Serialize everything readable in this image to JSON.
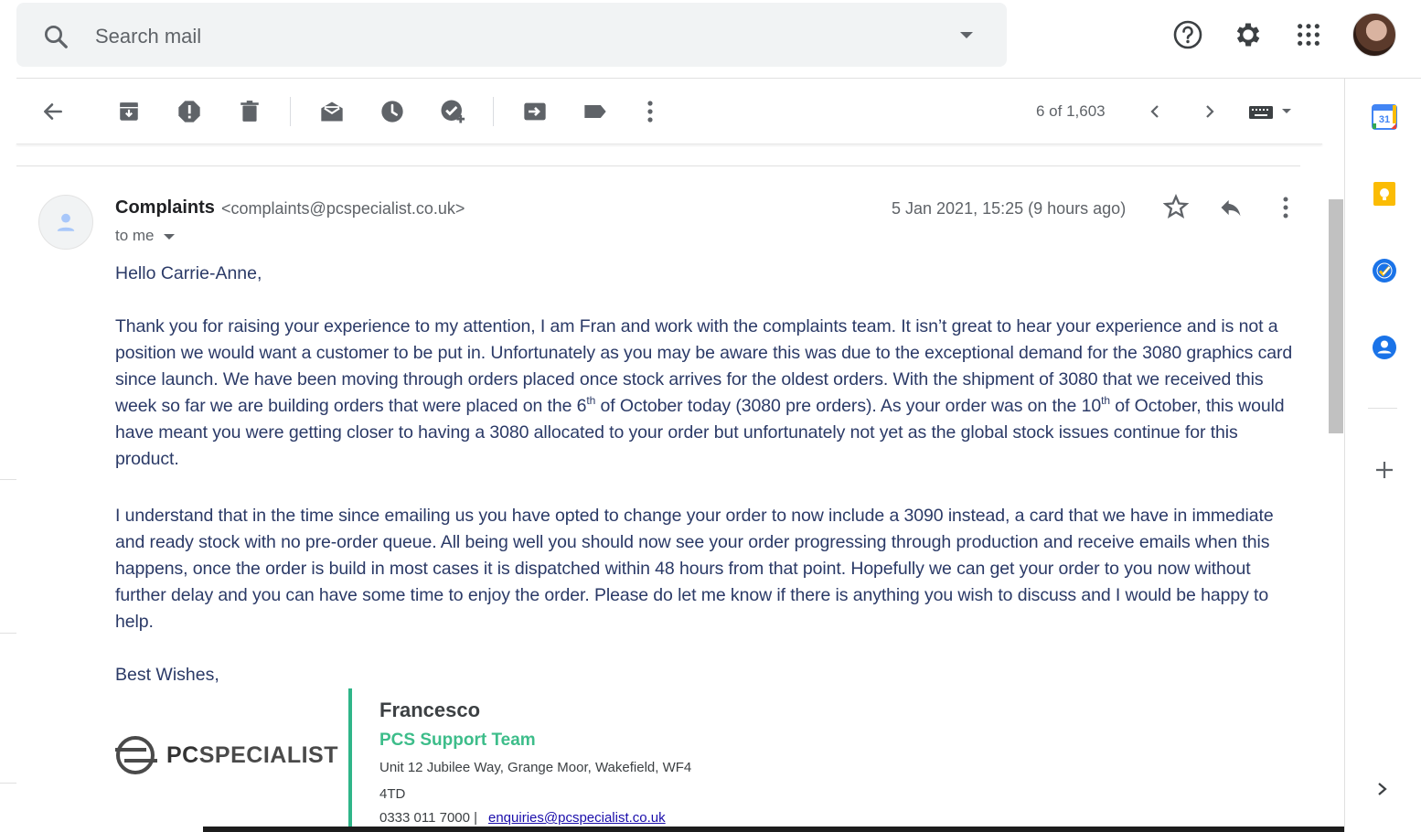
{
  "search": {
    "placeholder": "Search mail"
  },
  "toolbar": {
    "pager": "6 of 1,603"
  },
  "message": {
    "sender_name": "Complaints",
    "sender_email": "<complaints@pcspecialist.co.uk>",
    "recipient": "to me",
    "date": "5 Jan 2021, 15:25 (9 hours ago)",
    "greeting": "Hello Carrie-Anne,",
    "p1_a": "Thank you for raising your experience to my attention, I am Fran and work with the complaints team. It isn’t great to hear your experience and is not a position we would want a customer to be put in. Unfortunately as you may be aware this was due to the exceptional demand for the 3080 graphics card since launch. We have been moving through orders placed once stock arrives for the oldest orders. With the shipment of 3080 that we received this week so far we are building orders that were placed on the 6",
    "p1_sup1": "th",
    "p1_b": " of October today (3080 pre orders). As your order was on the 10",
    "p1_sup2": "th",
    "p1_c": " of October, this would have meant you were getting closer to having a 3080 allocated to your order but unfortunately not yet as the global stock issues continue for this product.",
    "p2": "I understand that in the time since emailing us you have opted to change your order to now include a 3090 instead, a card that we have in immediate and ready stock with no pre-order queue. All being well you should now see your order progressing through production and receive emails when this happens, once the order is build in most cases it is dispatched within 48 hours from that point. Hopefully we can get your order to you now without further delay and you can have some time to enjoy the order. Please do let me know if there is anything you wish to discuss and I would be happy to help.",
    "closing": "Best Wishes,"
  },
  "signature": {
    "logo_text_a": "PC",
    "logo_text_b": "SPECIALIST",
    "name": "Francesco",
    "team": "PCS Support Team",
    "address_line1": "Unit 12 Jubilee Way, Grange Moor, Wakefield, WF4",
    "address_line2": "4TD",
    "phone": "0333 011 7000 |",
    "email": "enquiries@pcspecialist.co.uk"
  },
  "side_panel": {
    "calendar_day": "31"
  },
  "colors": {
    "body_text": "#2b3a67",
    "signature_accent": "#2fb589",
    "icon_gray": "#5f6368"
  },
  "icons": [
    "search-icon",
    "dropdown-icon",
    "help-icon",
    "settings-icon",
    "apps-icon",
    "back-icon",
    "archive-icon",
    "report-spam-icon",
    "delete-icon",
    "mark-unread-icon",
    "snooze-icon",
    "add-task-icon",
    "move-to-icon",
    "label-icon",
    "more-icon",
    "prev-icon",
    "next-icon",
    "keyboard-icon",
    "star-icon",
    "reply-icon",
    "calendar-icon",
    "keep-icon",
    "tasks-icon",
    "contacts-icon",
    "add-icon",
    "expand-icon"
  ]
}
